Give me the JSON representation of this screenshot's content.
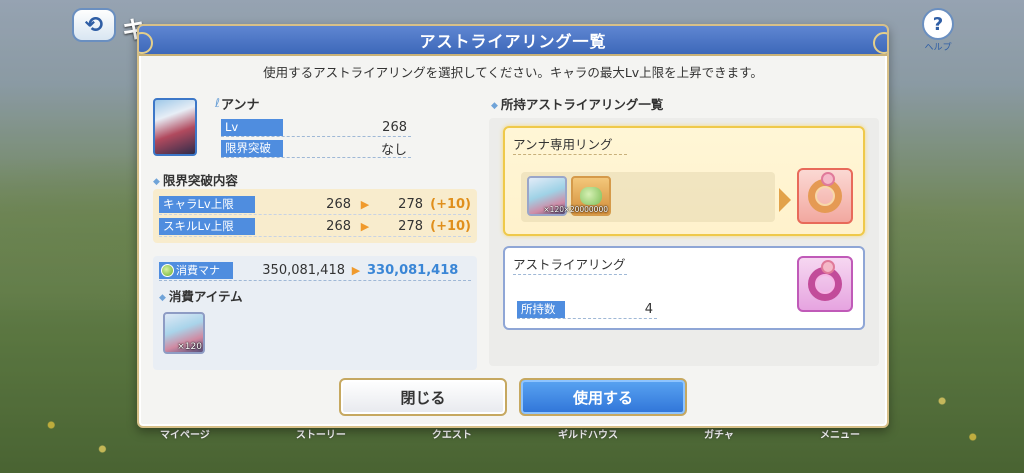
{
  "dialog": {
    "title": "アストライアリング一覧",
    "instruction": "使用するアストライアリングを選択してください。キャラの最大Lv上限を上昇できます。"
  },
  "background": {
    "back_label": "⟲",
    "title_fragment": "キ",
    "help_label": "ヘルプ",
    "nav_items": [
      "マイページ",
      "ストーリー",
      "クエスト",
      "ギルドハウス",
      "ガチャ",
      "メニュー"
    ]
  },
  "character": {
    "name": "アンナ",
    "lv_label": "Lv",
    "lv_value": "268",
    "limit_break_label": "限界突破",
    "limit_break_value": "なし"
  },
  "limit_break_contents": {
    "section_title": "限界突破内容",
    "rows": [
      {
        "label": "キャラLv上限",
        "from": "268",
        "to": "278",
        "delta": "(+10)"
      },
      {
        "label": "スキルLv上限",
        "from": "268",
        "to": "278",
        "delta": "(+10)"
      }
    ]
  },
  "cost": {
    "mana_label": "消費マナ",
    "mana_from": "350,081,418",
    "mana_to": "330,081,418",
    "items_title": "消費アイテム",
    "item_count": "×120"
  },
  "rings": {
    "section_title": "所持アストライアリング一覧",
    "exclusive": {
      "title": "アンナ専用リング",
      "material_a_count": "×120",
      "material_b_count": "×20000000"
    },
    "astraea": {
      "title": "アストライアリング",
      "owned_label": "所持数",
      "owned_value": "4"
    }
  },
  "buttons": {
    "close": "閉じる",
    "use": "使用する"
  },
  "colors": {
    "header_blue": "#3d68b9",
    "label_blue": "#4f8ddf",
    "delta_orange": "#e08f1c",
    "mana_to_blue": "#3a86d6",
    "gold_border": "#c6a860"
  }
}
